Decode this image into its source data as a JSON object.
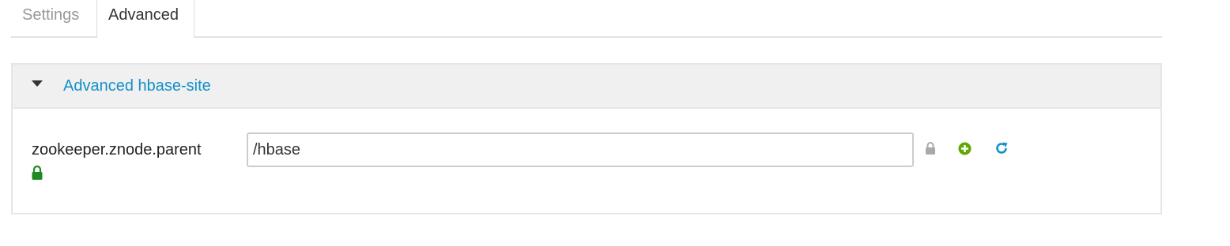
{
  "tabs": [
    {
      "label": "Settings",
      "active": false
    },
    {
      "label": "Advanced",
      "active": true
    }
  ],
  "section": {
    "title": "Advanced hbase-site",
    "expanded": true,
    "properties": [
      {
        "name": "zookeeper.znode.parent",
        "value": "/hbase",
        "locked": true,
        "icons": [
          "lock-icon",
          "add-override-icon",
          "undo-icon"
        ]
      }
    ]
  },
  "colors": {
    "link": "#1490c9",
    "lock_green": "#1f8a23",
    "plus_green": "#5fa800",
    "refresh_blue": "#1490c9",
    "lock_grey": "#aaaaaa"
  }
}
